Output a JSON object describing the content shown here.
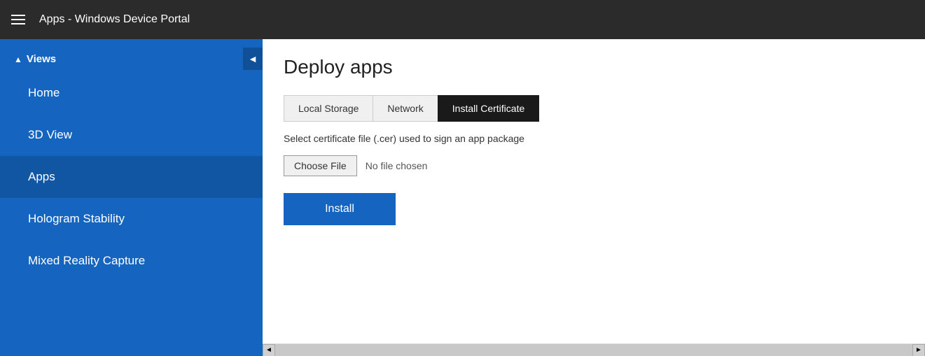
{
  "topbar": {
    "title": "Apps - Windows Device Portal"
  },
  "sidebar": {
    "views_label": "Views",
    "toggle_icon": "◄",
    "items": [
      {
        "label": "Home",
        "active": false
      },
      {
        "label": "3D View",
        "active": false
      },
      {
        "label": "Apps",
        "active": true
      },
      {
        "label": "Hologram Stability",
        "active": false
      },
      {
        "label": "Mixed Reality Capture",
        "active": false
      }
    ]
  },
  "content": {
    "page_title": "Deploy apps",
    "tabs": [
      {
        "label": "Local Storage",
        "active": false
      },
      {
        "label": "Network",
        "active": false
      },
      {
        "label": "Install Certificate",
        "active": true
      }
    ],
    "description": "Select certificate file (.cer) used to sign an app package",
    "choose_file_label": "Choose File",
    "no_file_text": "No file chosen",
    "install_label": "Install"
  },
  "scrollbar": {
    "left_arrow": "◄",
    "right_arrow": "►"
  }
}
